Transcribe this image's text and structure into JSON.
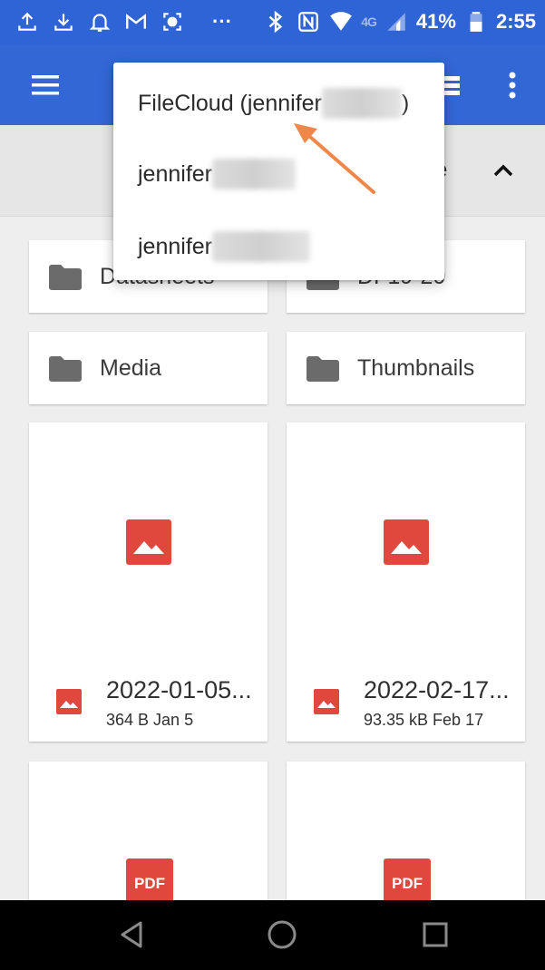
{
  "status_bar": {
    "left_icons": [
      "upload-icon",
      "download-icon",
      "bell-icon",
      "gmail-icon",
      "screen-record-icon",
      "more-dots-icon"
    ],
    "right_icons": [
      "bluetooth-icon",
      "nfc-icon",
      "wifi-icon",
      "signal-icon",
      "battery-icon"
    ],
    "network_label": "4G",
    "battery_percent": "41%",
    "time": "2:55",
    "more_dots": "···"
  },
  "app_bar": {
    "menu_icon": "hamburger-menu-icon",
    "view_icon": "list-view-icon",
    "overflow_icon": "more-vert-icon",
    "color": "#3367d6"
  },
  "sort_bar": {
    "label": "e",
    "toggle_icon": "chevron-up-icon"
  },
  "account_dropdown": {
    "items": [
      {
        "label": "FileCloud (jennifer",
        "suffix": ")"
      },
      {
        "label": "jennifer",
        "suffix": ""
      },
      {
        "label": "jennifer",
        "suffix": ""
      }
    ]
  },
  "folders": [
    {
      "name": "Datasheets",
      "icon": "folder-icon"
    },
    {
      "name": "DF19-20",
      "icon": "folder-icon"
    },
    {
      "name": "Media",
      "icon": "folder-icon"
    },
    {
      "name": "Thumbnails",
      "icon": "folder-icon"
    }
  ],
  "files": [
    {
      "name": "2022-01-05...",
      "meta": "364 B Jan 5",
      "icon": "image-file-icon"
    },
    {
      "name": "2022-02-17...",
      "meta": "93.35 kB Feb 17",
      "icon": "image-file-icon"
    }
  ],
  "pdf_files": [
    {
      "icon_text": "PDF",
      "icon": "pdf-icon"
    },
    {
      "icon_text": "PDF",
      "icon": "pdf-icon"
    }
  ],
  "nav_bar": {
    "buttons": [
      "back-icon",
      "home-icon",
      "recents-icon"
    ]
  },
  "colors": {
    "accent": "#3367d6",
    "status_bar": "#2f64d6",
    "image_icon_red": "#e0483e",
    "folder_gray": "#6b6b6b",
    "annotation_arrow": "#f0874a"
  }
}
